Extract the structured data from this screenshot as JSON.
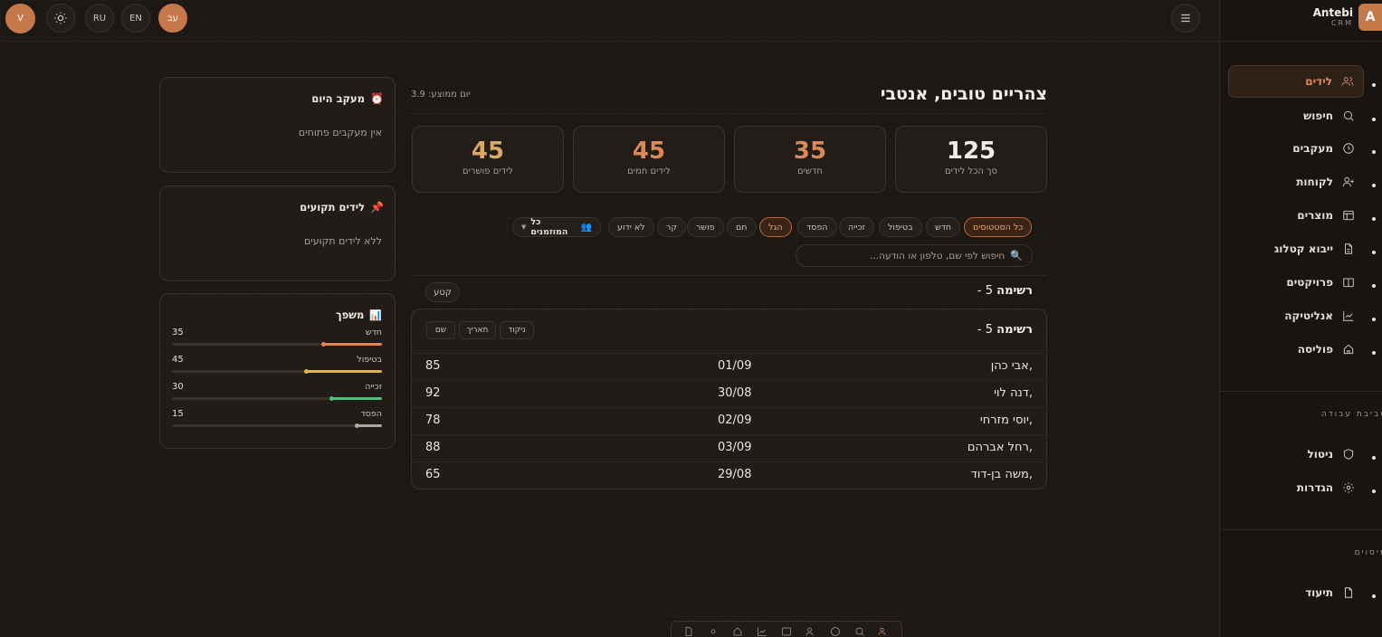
{
  "topbar": {
    "user_initial": "V",
    "lang_ru": "RU",
    "lang_en": "EN",
    "lang_he": "עב"
  },
  "brand": {
    "name": "Antebi",
    "sub": "CRM",
    "logo": "A"
  },
  "sidebar": {
    "items": [
      {
        "label": "לידים",
        "icon": "users-icon"
      },
      {
        "label": "חיפוש",
        "icon": "search-icon"
      },
      {
        "label": "מעקבים",
        "icon": "clock-icon"
      },
      {
        "label": "לקוחות",
        "icon": "user-plus-icon"
      },
      {
        "label": "מוצרים",
        "icon": "box-icon"
      },
      {
        "label": "ייבוא קטלוג",
        "icon": "file-icon"
      },
      {
        "label": "פרויקטים",
        "icon": "book-icon"
      },
      {
        "label": "אנליטיקה",
        "icon": "chart-icon"
      },
      {
        "label": "פוליסה",
        "icon": "home-icon"
      }
    ],
    "section_workspace": "סביבת עבודה",
    "workspace_items": [
      {
        "label": "ניטול",
        "icon": "shield-icon"
      },
      {
        "label": "הגדרות",
        "icon": "gear-icon"
      }
    ],
    "section_other": "מיסוים",
    "other_items": [
      {
        "label": "תיעוד",
        "icon": "doc-icon"
      }
    ]
  },
  "header": {
    "greeting": "צהריים טובים, אנטבי",
    "avg_day": "יום ממוצע: 3.9"
  },
  "stats": [
    {
      "value": "125",
      "label": "סך הכל לידים"
    },
    {
      "value": "35",
      "label": "חדשים"
    },
    {
      "value": "45",
      "label": "לידים חמים"
    },
    {
      "value": "45",
      "label": "לידים פושרים"
    }
  ],
  "filters": {
    "chips": [
      "כל הסטטוסים",
      "חדש",
      "בטיפול",
      "זכייה",
      "הפסד",
      "הגל",
      "חם",
      "פושר",
      "קר",
      "לא ידוע"
    ],
    "active_index": 0,
    "selected_index": 5,
    "owners_label": "כל המוזמנים",
    "search_placeholder": "חיפוש לפי שם, טלפון או הודעה..."
  },
  "list": {
    "title": "רשימה",
    "count_label": "5 -",
    "toggle_label": "קטע",
    "inner_title": "רשימה",
    "inner_count": "5 -",
    "sort_buttons": [
      "ניקוד",
      "תאריך",
      "שם"
    ],
    "rows": [
      {
        "name": "אבי כהן,",
        "date": "01/09",
        "score": "85"
      },
      {
        "name": "דנה לוי,",
        "date": "30/08",
        "score": "92"
      },
      {
        "name": "יוסי מזרחי,",
        "date": "02/09",
        "score": "78"
      },
      {
        "name": "רחל אברהם,",
        "date": "03/09",
        "score": "88"
      },
      {
        "name": "משה בן-דוד,",
        "date": "29/08",
        "score": "65"
      }
    ]
  },
  "panels": {
    "today": {
      "title": "מעקב היום",
      "icon": "alarm-icon",
      "empty": "אין מעקבים פתוחים"
    },
    "pinned": {
      "title": "לידים תקועים",
      "icon": "pin-icon",
      "empty": "ללא לידים תקועים"
    },
    "pipeline": {
      "title": "משפך",
      "icon": "bar-chart-icon",
      "rows": [
        {
          "label": "חדש",
          "value": "35",
          "fraction": 0.28,
          "color": "#e0884f"
        },
        {
          "label": "בטיפול",
          "value": "45",
          "fraction": 0.36,
          "color": "#e0b54f"
        },
        {
          "label": "זכייה",
          "value": "30",
          "fraction": 0.24,
          "color": "#4fc07a"
        },
        {
          "label": "הפסד",
          "value": "15",
          "fraction": 0.12,
          "color": "#b0a89e"
        }
      ]
    }
  }
}
